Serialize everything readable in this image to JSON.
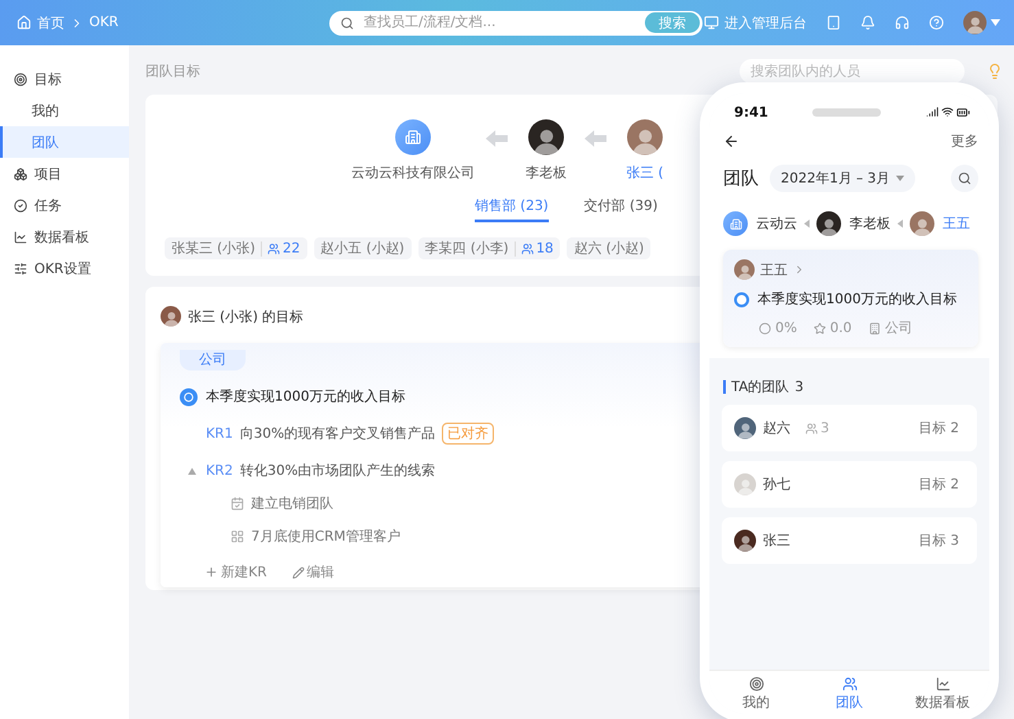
{
  "header": {
    "breadcrumb": [
      {
        "label": "首页"
      },
      {
        "label": "OKR"
      }
    ],
    "search": {
      "placeholder": "查找员工/流程/文档...",
      "button": "搜索"
    },
    "admin_link": "进入管理后台"
  },
  "sidebar": {
    "items": [
      {
        "label": "目标",
        "selected": false,
        "children": [
          {
            "label": "我的",
            "selected": false
          },
          {
            "label": "团队",
            "selected": true
          }
        ]
      },
      {
        "label": "项目",
        "selected": false
      },
      {
        "label": "任务",
        "selected": false
      },
      {
        "label": "数据看板",
        "selected": false
      },
      {
        "label": "OKR设置",
        "selected": false
      }
    ]
  },
  "page": {
    "title": "团队目标",
    "member_search": {
      "placeholder": "搜索团队内的人员"
    }
  },
  "org_chain": [
    {
      "name": "云动云科技有限公司",
      "kind": "company",
      "current": false
    },
    {
      "name": "李老板",
      "kind": "person",
      "current": false
    },
    {
      "name": "张三 (",
      "kind": "person",
      "current": true
    }
  ],
  "departments": [
    {
      "label": "销售部 (23)",
      "selected": true
    },
    {
      "label": "交付部 (39)",
      "selected": false
    }
  ],
  "members": [
    {
      "name": "张某三 (小张)",
      "count": "22"
    },
    {
      "name": "赵小五 (小赵)"
    },
    {
      "name": "李某四 (小李)",
      "count": "18"
    },
    {
      "name": "赵六 (小赵)"
    }
  ],
  "goal_card": {
    "title": "张三 (小张) 的目标",
    "tag": "公司",
    "objective": "本季度实现1000万元的收入目标",
    "key_results": [
      {
        "code": "KR1",
        "text": "向30%的现有客户交叉销售产品",
        "badge": "已对齐"
      },
      {
        "code": "KR2",
        "text": "转化30%由市场团队产生的线索",
        "expanded": true,
        "children": [
          {
            "text": "建立电销团队",
            "kind": "task"
          },
          {
            "text": "7月底使用CRM管理客户",
            "kind": "project"
          }
        ]
      }
    ],
    "actions": [
      {
        "label": "新建KR",
        "kind": "add"
      },
      {
        "label": "编辑",
        "kind": "edit"
      }
    ]
  },
  "phone": {
    "time": "9:41",
    "more": "更多",
    "title": "团队",
    "period": "2022年1月 – 3月",
    "chain": [
      {
        "name": "云动云",
        "kind": "company",
        "current": false
      },
      {
        "name": "李老板",
        "kind": "person",
        "current": false
      },
      {
        "name": "王五",
        "kind": "person",
        "current": true
      }
    ],
    "owner_card": {
      "name": "王五",
      "objective": "本季度实现1000万元的收入目标",
      "progress": "0%",
      "score": "0.0",
      "scope": "公司"
    },
    "team": {
      "title": "TA的团队",
      "count": "3",
      "members": [
        {
          "name": "赵六",
          "subordinates": "3",
          "goals": "目标 2"
        },
        {
          "name": "孙七",
          "goals": "目标 2"
        },
        {
          "name": "张三",
          "goals": "目标 3"
        }
      ]
    },
    "tabs": [
      {
        "label": "我的",
        "selected": false
      },
      {
        "label": "团队",
        "selected": true
      },
      {
        "label": "数据看板",
        "selected": false
      }
    ]
  }
}
